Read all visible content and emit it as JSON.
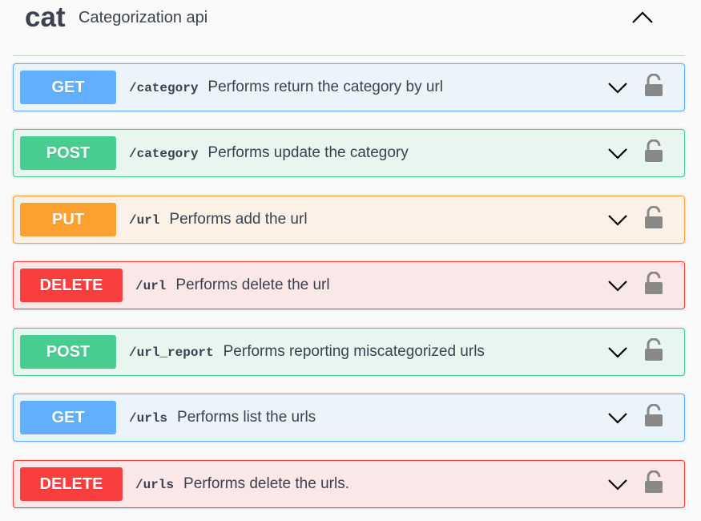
{
  "tag": {
    "name": "cat",
    "description": "Categorization api",
    "toggle_icon": "chevron-up-icon"
  },
  "colors": {
    "get": "#61affe",
    "post": "#49cc90",
    "put": "#fca130",
    "delete": "#f93e3e"
  },
  "operations": [
    {
      "method": "GET",
      "path": "/category",
      "description": "Performs return the category by url",
      "expand_icon": "chevron-down-icon",
      "auth_icon": "lock-icon"
    },
    {
      "method": "POST",
      "path": "/category",
      "description": "Performs update the category",
      "expand_icon": "chevron-down-icon",
      "auth_icon": "lock-icon"
    },
    {
      "method": "PUT",
      "path": "/url",
      "description": "Performs add the url",
      "expand_icon": "chevron-down-icon",
      "auth_icon": "lock-icon"
    },
    {
      "method": "DELETE",
      "path": "/url",
      "description": "Performs delete the url",
      "expand_icon": "chevron-down-icon",
      "auth_icon": "lock-icon"
    },
    {
      "method": "POST",
      "path": "/url_report",
      "description": "Performs reporting miscategorized urls",
      "expand_icon": "chevron-down-icon",
      "auth_icon": "lock-icon"
    },
    {
      "method": "GET",
      "path": "/urls",
      "description": "Performs list the urls",
      "expand_icon": "chevron-down-icon",
      "auth_icon": "lock-icon"
    },
    {
      "method": "DELETE",
      "path": "/urls",
      "description": "Performs delete the urls.",
      "expand_icon": "chevron-down-icon",
      "auth_icon": "lock-icon"
    }
  ]
}
